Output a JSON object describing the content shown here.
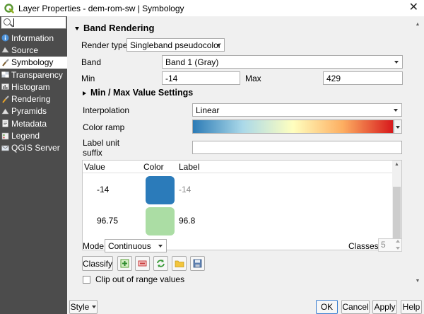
{
  "window": {
    "title": "Layer Properties - dem-rom-sw | Symbology",
    "close_glyph": "✕"
  },
  "sidebar": {
    "search_placeholder": "",
    "items": [
      {
        "label": "Information",
        "icon": "info-icon",
        "active": false
      },
      {
        "label": "Source",
        "icon": "source-icon",
        "active": false
      },
      {
        "label": "Symbology",
        "icon": "symbology-brush-icon",
        "active": true
      },
      {
        "label": "Transparency",
        "icon": "transparency-icon",
        "active": false
      },
      {
        "label": "Histogram",
        "icon": "histogram-icon",
        "active": false
      },
      {
        "label": "Rendering",
        "icon": "rendering-brush-icon",
        "active": false
      },
      {
        "label": "Pyramids",
        "icon": "pyramids-icon",
        "active": false
      },
      {
        "label": "Metadata",
        "icon": "metadata-icon",
        "active": false
      },
      {
        "label": "Legend",
        "icon": "legend-icon",
        "active": false
      },
      {
        "label": "QGIS Server",
        "icon": "server-icon",
        "active": false
      }
    ]
  },
  "band_rendering": {
    "section_title": "Band Rendering",
    "render_type_label": "Render type",
    "render_type_value": "Singleband pseudocolor",
    "band_label": "Band",
    "band_value": "Band 1 (Gray)",
    "min_label": "Min",
    "min_value": "-14",
    "max_label": "Max",
    "max_value": "429",
    "minmax_section_title": "Min / Max Value Settings",
    "interpolation_label": "Interpolation",
    "interpolation_value": "Linear",
    "color_ramp_label": "Color ramp",
    "color_ramp_colors": [
      "#2c7bb6",
      "#abd9e9",
      "#ffffbf",
      "#fdae61",
      "#d7191c"
    ],
    "label_unit_suffix_label_1": "Label unit",
    "label_unit_suffix_label_2": "suffix",
    "label_unit_suffix_value": ""
  },
  "class_table": {
    "headers": {
      "value": "Value",
      "color": "Color",
      "label": "Label"
    },
    "rows": [
      {
        "value": "-14",
        "color": "#2b7bba",
        "label": "-14",
        "label_muted": true
      },
      {
        "value": "96.75",
        "color": "#abdda4",
        "label": "96.8",
        "label_muted": false
      }
    ]
  },
  "mode": {
    "mode_label": "Mode",
    "mode_value": "Continuous",
    "classes_label": "Classes",
    "classes_value": "5"
  },
  "actions": {
    "classify_label": "Classify",
    "clip_label": "Clip out of range values"
  },
  "footer": {
    "style_label": "Style",
    "ok_label": "OK",
    "cancel_label": "Cancel",
    "apply_label": "Apply",
    "help_label": "Help"
  }
}
